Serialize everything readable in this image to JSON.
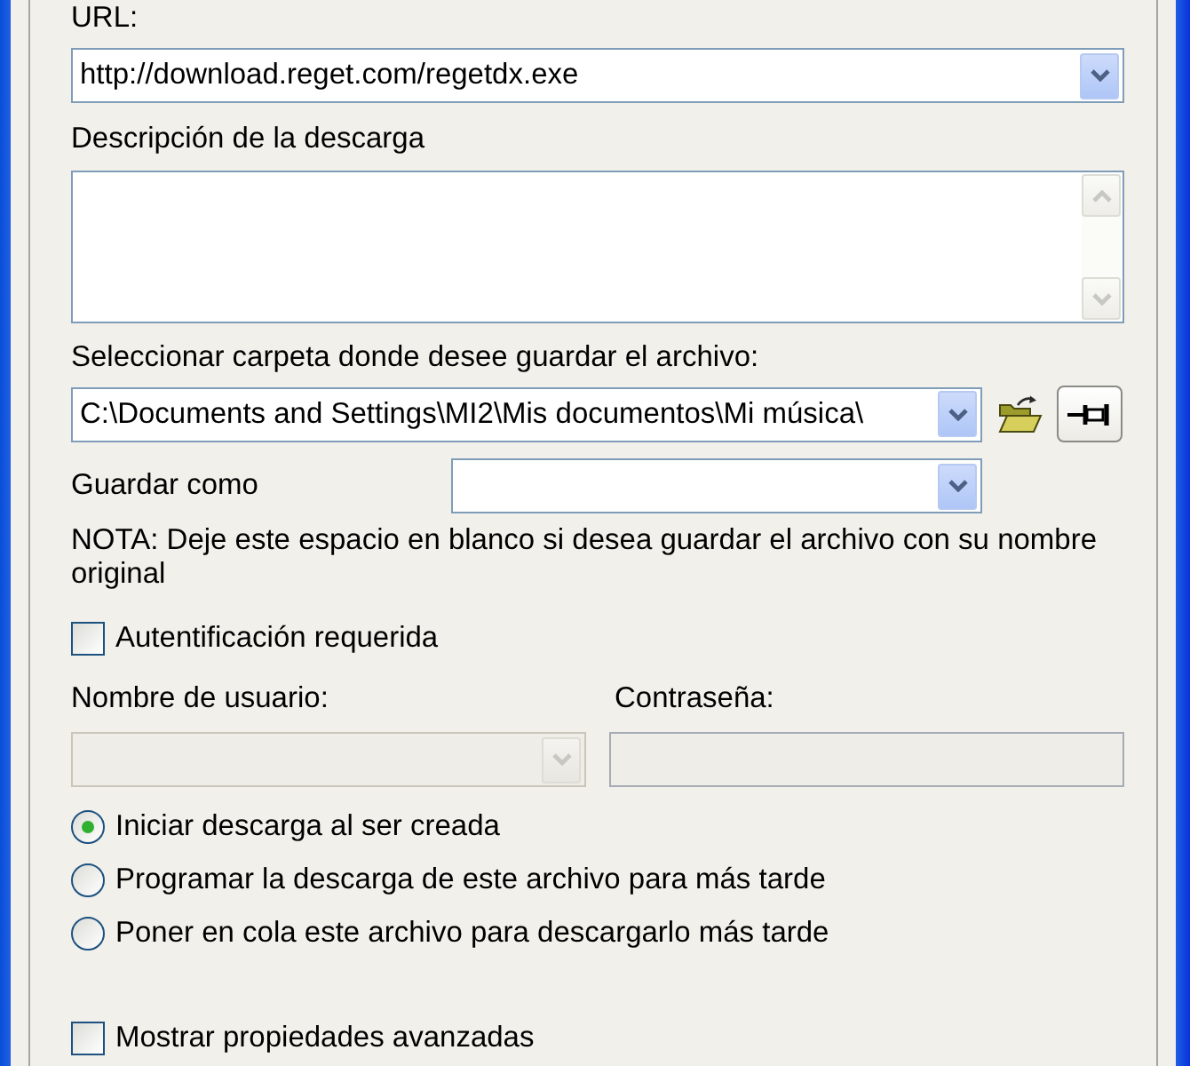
{
  "url": {
    "label": "URL:",
    "value": "http://download.reget.com/regetdx.exe"
  },
  "description": {
    "label": "Descripción de la descarga"
  },
  "folder": {
    "label": "Seleccionar carpeta donde desee guardar el archivo:",
    "value": "C:\\Documents and Settings\\MI2\\Mis documentos\\Mi música\\"
  },
  "save_as": {
    "label": "Guardar como"
  },
  "note": "NOTA: Deje este espacio en blanco si desea guardar el archivo con su nombre original",
  "auth": {
    "label": "Autentificación requerida",
    "checked": false
  },
  "username": {
    "label": "Nombre de usuario:",
    "disabled": true
  },
  "password": {
    "label": "Contraseña:",
    "disabled": true
  },
  "start_options": [
    {
      "label": "Iniciar descarga al ser creada",
      "selected": true
    },
    {
      "label": "Programar la descarga de este archivo para más tarde",
      "selected": false
    },
    {
      "label": "Poner en cola este archivo para descargarlo más tarde",
      "selected": false
    }
  ],
  "advanced": {
    "label": "Mostrar propiedades avanzadas",
    "checked": false
  }
}
